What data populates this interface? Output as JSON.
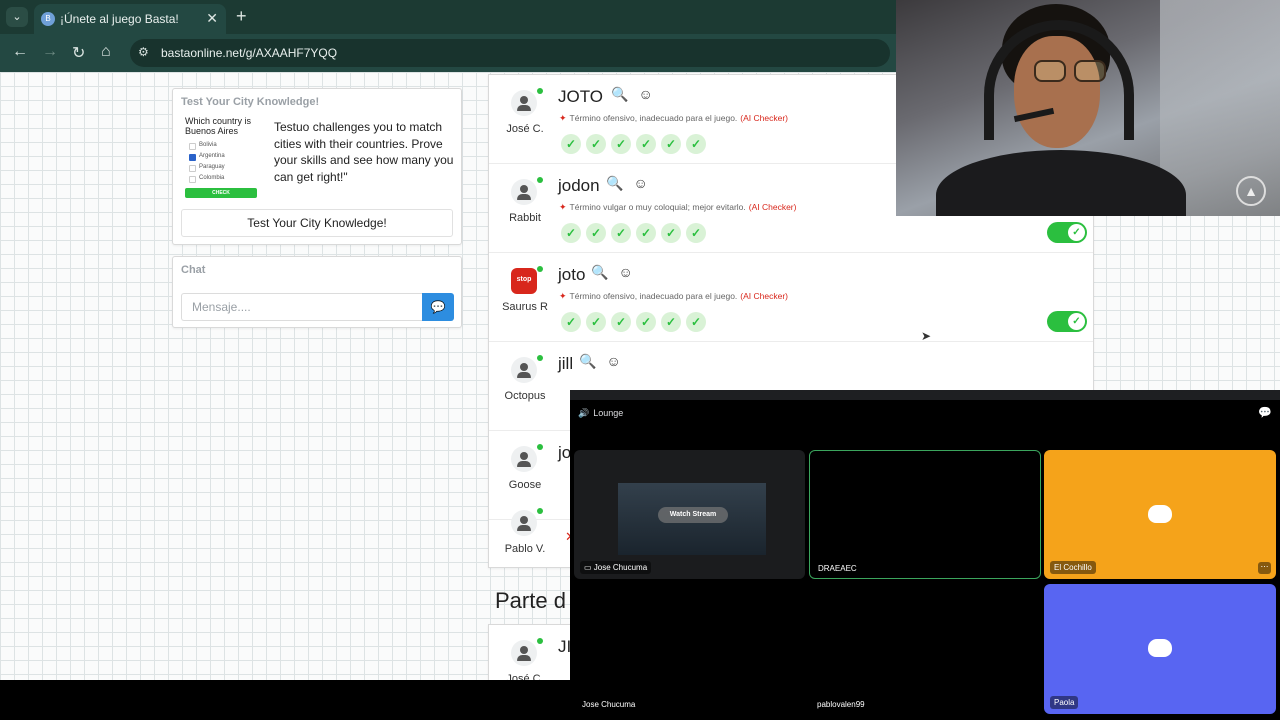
{
  "browser": {
    "tab_title": "¡Únete al juego Basta!",
    "url": "bastaonline.net/g/AXAAHF7YQQ",
    "icons": [
      "tab-menu",
      "close",
      "plus",
      "back-arrow",
      "forward-arrow",
      "reload",
      "home",
      "site-info"
    ]
  },
  "promo": {
    "heading": "Test Your City Knowledge!",
    "quiz_question": "Which country is Buenos Aires",
    "quiz_options": [
      "Bolivia",
      "Argentina",
      "Paraguay",
      "Colombia"
    ],
    "quiz_selected": "Argentina",
    "quiz_button": "CHECK",
    "text": "Testuo challenges you to match cities with their countries. Prove your skills and see how many you can get right!\"",
    "button": "Test Your City Knowledge!"
  },
  "chat": {
    "heading": "Chat",
    "placeholder": "Mensaje...."
  },
  "results": {
    "rows": [
      {
        "player": "José C.",
        "word": "JOTO",
        "warning": "Término ofensivo, inadecuado para el juego.",
        "checker": "(AI Checker)",
        "checks": 6,
        "toggle_on": false,
        "avatar": "person"
      },
      {
        "player": "Rabbit",
        "word": "jodon",
        "warning": "Término vulgar o muy coloquial; mejor evitarlo.",
        "checker": "(AI Checker)",
        "checks": 6,
        "toggle_on": true,
        "avatar": "person"
      },
      {
        "player": "Saurus R",
        "word": "joto",
        "warning": "Término ofensivo, inadecuado para el juego.",
        "checker": "(AI Checker)",
        "checks": 6,
        "toggle_on": true,
        "avatar": "stop"
      },
      {
        "player": "Octopus",
        "word": "jill",
        "warning": "",
        "checker": "",
        "checks": 0,
        "toggle_on": false,
        "avatar": "person"
      },
      {
        "player": "Goose",
        "word": "jo",
        "warning": "",
        "checker": "",
        "checks": 0,
        "toggle_on": false,
        "avatar": "person"
      },
      {
        "player": "Pablo V.",
        "word": "",
        "warning": "",
        "checker": "",
        "checks": 0,
        "toggle_on": false,
        "avatar": "person"
      }
    ],
    "stop_label": "stop",
    "section_title": "Parte d",
    "next_row": {
      "player": "José C.",
      "word": "JI"
    }
  },
  "discord": {
    "channel": "Lounge",
    "watch_stream": "Watch Stream",
    "tiles": {
      "stream": "Jose Chucuma",
      "draeaec": "DRAEAEC",
      "cochillo": "El Cochillo",
      "jose2": "Jose Chucuma",
      "pablo": "pablovalen99",
      "paola": "Paola"
    },
    "colors": {
      "cochillo": "#f5a31a",
      "paola": "#5865f2",
      "speaking": "#3ba55d"
    }
  },
  "colors": {
    "green": "#2bbf3f",
    "blue": "#2d8de0",
    "red": "#d8271c",
    "chrome": "#234842"
  }
}
